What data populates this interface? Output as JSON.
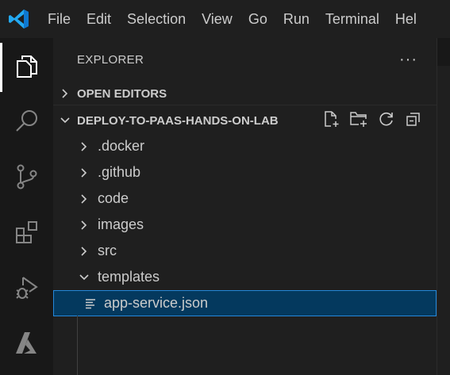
{
  "menu": [
    "File",
    "Edit",
    "Selection",
    "View",
    "Go",
    "Run",
    "Terminal",
    "Hel"
  ],
  "activity_bar": [
    {
      "name": "explorer",
      "icon": "files-icon",
      "active": true
    },
    {
      "name": "search",
      "icon": "search-icon",
      "active": false
    },
    {
      "name": "source-control",
      "icon": "source-control-icon",
      "active": false
    },
    {
      "name": "extensions",
      "icon": "extensions-icon",
      "active": false
    },
    {
      "name": "run-debug",
      "icon": "run-debug-icon",
      "active": false
    },
    {
      "name": "azure",
      "icon": "azure-icon",
      "active": false
    }
  ],
  "sidebar": {
    "title": "EXPLORER",
    "more": "···",
    "open_editors": "OPEN EDITORS",
    "folder": "DEPLOY-TO-PAAS-HANDS-ON-LAB",
    "items": [
      {
        "label": ".docker",
        "type": "folder",
        "expanded": false
      },
      {
        "label": ".github",
        "type": "folder",
        "expanded": false
      },
      {
        "label": "code",
        "type": "folder",
        "expanded": false
      },
      {
        "label": "images",
        "type": "folder",
        "expanded": false
      },
      {
        "label": "src",
        "type": "folder",
        "expanded": false
      },
      {
        "label": "templates",
        "type": "folder",
        "expanded": true
      },
      {
        "label": "app-service.json",
        "type": "file",
        "selected": true
      }
    ]
  },
  "colors": {
    "accent": "#0078d4",
    "selection_bg": "#04395e",
    "selection_border": "#2488db",
    "vscode_blue": "#3a96dd"
  }
}
